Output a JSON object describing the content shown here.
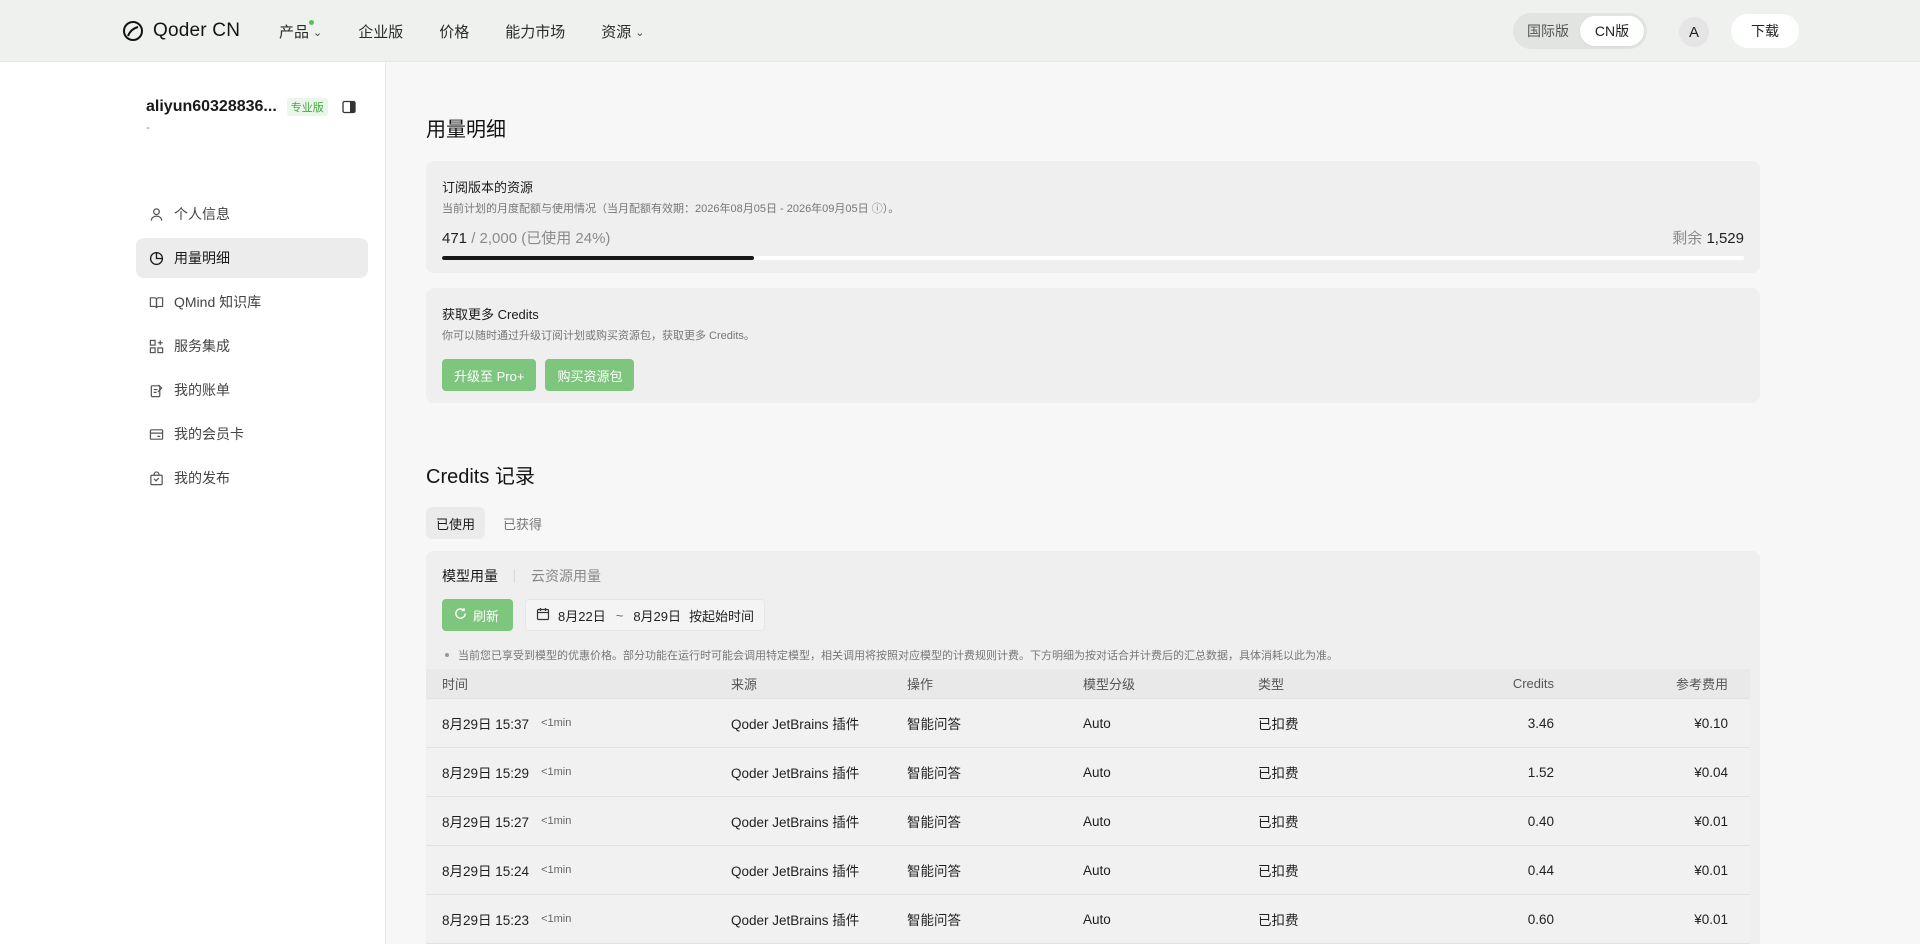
{
  "header": {
    "brand": "Qoder CN",
    "nav": [
      {
        "label": "产品",
        "has_dropdown": true,
        "has_dot": true
      },
      {
        "label": "企业版",
        "has_dropdown": false
      },
      {
        "label": "价格",
        "has_dropdown": false
      },
      {
        "label": "能力市场",
        "has_dropdown": false
      },
      {
        "label": "资源",
        "has_dropdown": true
      }
    ],
    "region": {
      "international": "国际版",
      "cn": "CN版",
      "active": "cn"
    },
    "avatar_letter": "A",
    "download": "下载"
  },
  "sidebar": {
    "username": "aliyun60328836...",
    "plan_badge": "专业版",
    "subline": "-",
    "items": [
      {
        "label": "个人信息",
        "icon": "user-icon",
        "active": false
      },
      {
        "label": "用量明细",
        "icon": "pie-chart-icon",
        "active": true
      },
      {
        "label": "QMind 知识库",
        "icon": "book-icon",
        "active": false
      },
      {
        "label": "服务集成",
        "icon": "grid-plus-icon",
        "active": false
      },
      {
        "label": "我的账单",
        "icon": "bill-icon",
        "active": false
      },
      {
        "label": "我的会员卡",
        "icon": "card-icon",
        "active": false
      },
      {
        "label": "我的发布",
        "icon": "bag-icon",
        "active": false
      }
    ]
  },
  "main": {
    "title": "用量明细",
    "quota": {
      "title": "订阅版本的资源",
      "desc": "当前计划的月度配额与使用情况（当月配额有效期：2026年08月05日 - 2026年09月05日 ⓘ）。",
      "used": "471",
      "total": "/ 2,000",
      "pct_text": "(已使用 24%)",
      "remain_label": "剩余",
      "remain_value": "1,529",
      "progress": 0.24
    },
    "credits": {
      "title": "获取更多 Credits",
      "desc": "你可以随时通过升级订阅计划或购买资源包，获取更多 Credits。",
      "upgrade": "升级至 Pro+",
      "buy": "购买资源包"
    },
    "records": {
      "title": "Credits 记录",
      "tabs": [
        "已使用",
        "已获得"
      ],
      "subtabs": [
        "模型用量",
        "云资源用量"
      ],
      "refresh": "刷新",
      "date_start": "8月22日",
      "date_sep": "~",
      "date_end": "8月29日",
      "date_mode": "按起始时间",
      "notice": "当前您已享受到模型的优惠价格。部分功能在运行时可能会调用特定模型，相关调用将按照对应模型的计费规则计费。下方明细为按对话合并计费后的汇总数据，具体消耗以此为准。",
      "columns": [
        "时间",
        "来源",
        "操作",
        "模型分级",
        "类型",
        "Credits",
        "参考费用"
      ],
      "rows": [
        {
          "time": "8月29日 15:37",
          "dur": "<1min",
          "source": "Qoder JetBrains 插件",
          "op": "智能问答",
          "tier": "Auto",
          "type": "已扣费",
          "credits": "3.46",
          "cost": "¥0.10"
        },
        {
          "time": "8月29日 15:29",
          "dur": "<1min",
          "source": "Qoder JetBrains 插件",
          "op": "智能问答",
          "tier": "Auto",
          "type": "已扣费",
          "credits": "1.52",
          "cost": "¥0.04"
        },
        {
          "time": "8月29日 15:27",
          "dur": "<1min",
          "source": "Qoder JetBrains 插件",
          "op": "智能问答",
          "tier": "Auto",
          "type": "已扣费",
          "credits": "0.40",
          "cost": "¥0.01"
        },
        {
          "time": "8月29日 15:24",
          "dur": "<1min",
          "source": "Qoder JetBrains 插件",
          "op": "智能问答",
          "tier": "Auto",
          "type": "已扣费",
          "credits": "0.44",
          "cost": "¥0.01"
        },
        {
          "time": "8月29日 15:23",
          "dur": "<1min",
          "source": "Qoder JetBrains 插件",
          "op": "智能问答",
          "tier": "Auto",
          "type": "已扣费",
          "credits": "0.60",
          "cost": "¥0.01"
        }
      ]
    }
  },
  "colors": {
    "accent_green": "#7ec57e",
    "progress_fill": "#161616"
  }
}
